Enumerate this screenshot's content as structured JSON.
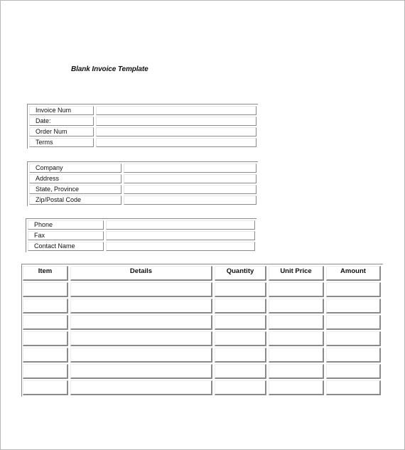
{
  "document": {
    "title": "Blank Invoice Template"
  },
  "invoice_info": {
    "fields": [
      {
        "label": "Invoice Num",
        "value": ""
      },
      {
        "label": "Date:",
        "value": ""
      },
      {
        "label": "Order Num",
        "value": ""
      },
      {
        "label": "Terms",
        "value": ""
      }
    ]
  },
  "company_info": {
    "fields": [
      {
        "label": "Company",
        "value": ""
      },
      {
        "label": "Address",
        "value": ""
      },
      {
        "label": "State, Province",
        "value": ""
      },
      {
        "label": "Zip/Postal Code",
        "value": ""
      }
    ]
  },
  "contact_info": {
    "fields": [
      {
        "label": "Phone",
        "value": ""
      },
      {
        "label": "Fax",
        "value": ""
      },
      {
        "label": "Contact Name",
        "value": ""
      }
    ]
  },
  "items_table": {
    "headers": [
      "Item",
      "Details",
      "Quantity",
      "Unit Price",
      "Amount"
    ],
    "rows": [
      [
        "",
        "",
        "",
        "",
        ""
      ],
      [
        "",
        "",
        "",
        "",
        ""
      ],
      [
        "",
        "",
        "",
        "",
        ""
      ],
      [
        "",
        "",
        "",
        "",
        ""
      ],
      [
        "",
        "",
        "",
        "",
        ""
      ],
      [
        "",
        "",
        "",
        "",
        ""
      ],
      [
        "",
        "",
        "",
        "",
        ""
      ]
    ]
  }
}
